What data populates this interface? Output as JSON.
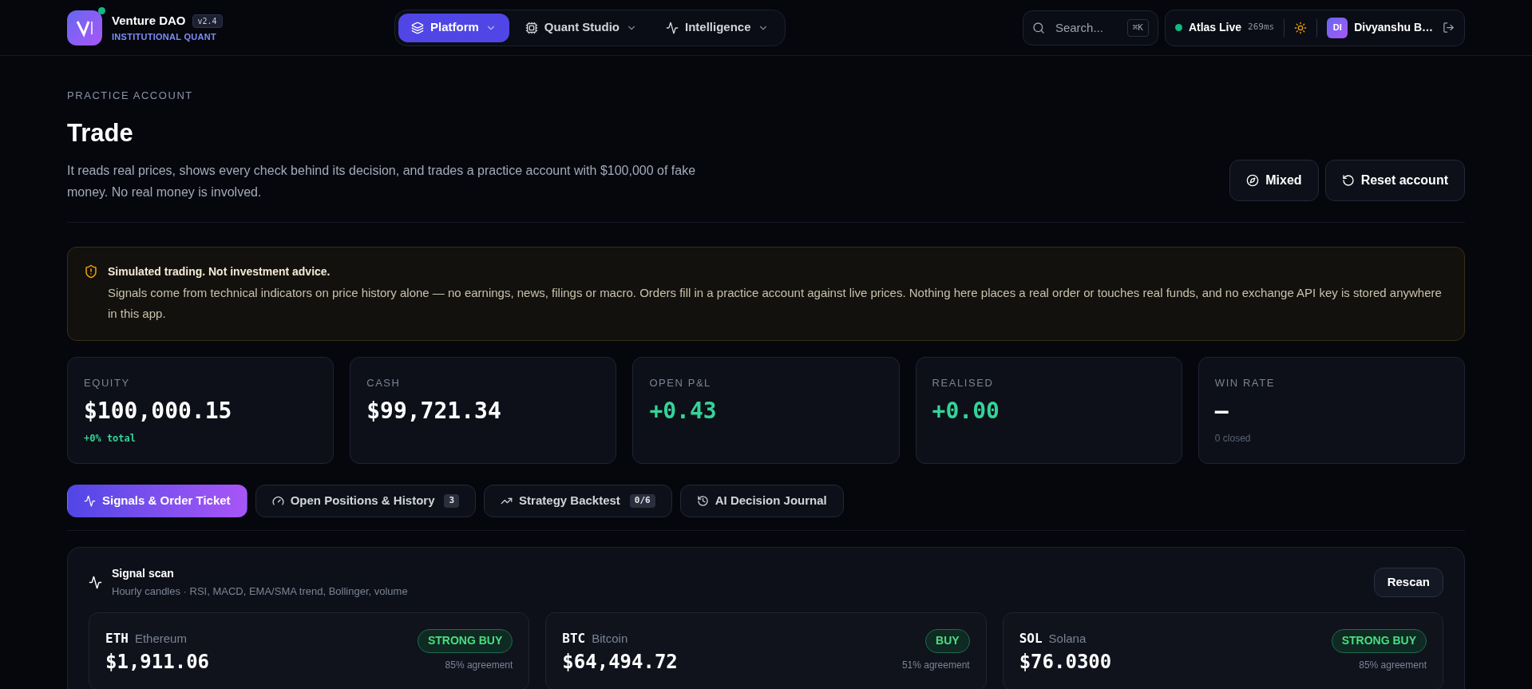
{
  "brand": {
    "name": "Venture DAO",
    "version": "v2.4",
    "tagline": "INSTITUTIONAL QUANT",
    "online": true
  },
  "nav": [
    {
      "label": "Platform",
      "selected": true
    },
    {
      "label": "Quant Studio",
      "selected": false
    },
    {
      "label": "Intelligence",
      "selected": false
    }
  ],
  "search": {
    "placeholder": "Search...",
    "shortcut": "⌘K"
  },
  "status": {
    "label": "Atlas Live",
    "latency": "269ms",
    "live": true
  },
  "user": {
    "initials": "DI",
    "name": "Divyanshu B…"
  },
  "page": {
    "eyebrow": "PRACTICE ACCOUNT",
    "title": "Trade",
    "description": "It reads real prices, shows every check behind its decision, and trades a practice account with $100,000 of fake money. No real money is involved.",
    "buttons": [
      "Mixed",
      "Reset account"
    ]
  },
  "notice": {
    "title": "Simulated trading. Not investment advice.",
    "body": "Signals come from technical indicators on price history alone — no earnings, news, filings or macro. Orders fill in a practice account against live prices. Nothing here places a real order or touches real funds, and no exchange API key is stored anywhere in this app."
  },
  "stats": [
    {
      "label": "EQUITY",
      "value": "$100,000.15",
      "positive": false,
      "sub": "+0% total",
      "sub_positive": true
    },
    {
      "label": "CASH",
      "value": "$99,721.34",
      "positive": false
    },
    {
      "label": "OPEN P&L",
      "value": "+0.43",
      "positive": true
    },
    {
      "label": "REALISED",
      "value": "+0.00",
      "positive": true
    },
    {
      "label": "WIN RATE",
      "value": "—",
      "positive": false,
      "sub": "0 closed",
      "sub_positive": false
    }
  ],
  "tabs": [
    {
      "label": "Signals & Order Ticket",
      "selected": true
    },
    {
      "label": "Open Positions & History",
      "selected": false,
      "count": "3"
    },
    {
      "label": "Strategy Backtest",
      "selected": false,
      "count": "0/6"
    },
    {
      "label": "AI Decision Journal",
      "selected": false
    }
  ],
  "scan": {
    "title": "Signal scan",
    "subtitle": "Hourly candles · RSI, MACD, EMA/SMA trend, Bollinger, volume",
    "button": "Rescan"
  },
  "signals": [
    {
      "symbol": "ETH",
      "name": "Ethereum",
      "price": "$1,911.06",
      "signal": "STRONG BUY",
      "agreement": "85% agreement"
    },
    {
      "symbol": "BTC",
      "name": "Bitcoin",
      "price": "$64,494.72",
      "signal": "BUY",
      "agreement": "51% agreement"
    },
    {
      "symbol": "SOL",
      "name": "Solana",
      "price": "$76.0300",
      "signal": "STRONG BUY",
      "agreement": "85% agreement"
    }
  ]
}
